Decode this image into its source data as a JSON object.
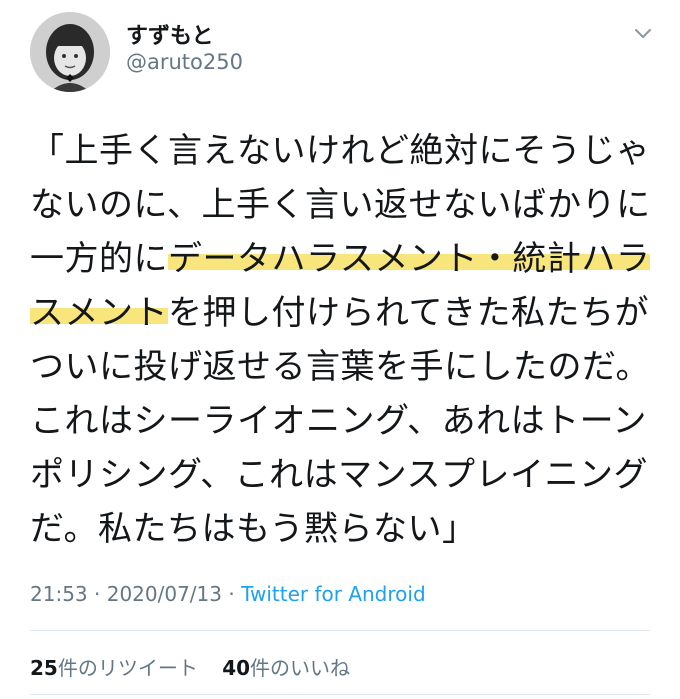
{
  "user": {
    "display_name": "すずもと",
    "handle": "@aruto250",
    "avatar_icon": "user-avatar-icon"
  },
  "tweet": {
    "lines": [
      {
        "a": "「上手く言えないけれど絶対にそうじゃ",
        "hl": "",
        "b": ""
      },
      {
        "a": "ないのに、上手く言い返せないばかりに",
        "hl": "",
        "b": ""
      },
      {
        "a": "一方的に",
        "hl": "データハラスメント・統計ハラ",
        "b": ""
      },
      {
        "a": "",
        "hl": "スメント",
        "b": "を押し付けられてきた私たちが"
      },
      {
        "a": "ついに投げ返せる言葉を手にしたのだ。",
        "hl": "",
        "b": ""
      },
      {
        "a": "これはシーライオニング、あれはトーン",
        "hl": "",
        "b": ""
      },
      {
        "a": "ポリシング、これはマンスプレイニング",
        "hl": "",
        "b": ""
      },
      {
        "a": "だ。私たちはもう黙らない」",
        "hl": "",
        "b": ""
      }
    ],
    "highlight_color": "#f7e266"
  },
  "meta": {
    "time": "21:53",
    "sep1": " · ",
    "date": "2020/07/13",
    "sep2": " · ",
    "app": "Twitter for Android"
  },
  "stats": {
    "retweets_count": "25",
    "retweets_label": "件のリツイート",
    "likes_count": "40",
    "likes_label": "件のいいね"
  },
  "colors": {
    "text": "#14171a",
    "secondary": "#657786",
    "link": "#1da1f2"
  }
}
